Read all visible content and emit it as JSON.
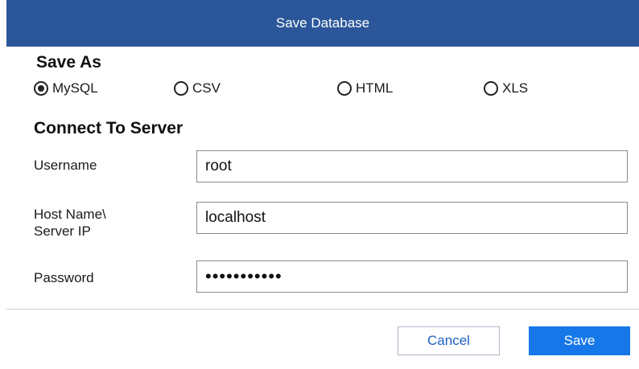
{
  "window": {
    "title": "Save Database"
  },
  "save_as": {
    "heading": "Save As",
    "options": [
      {
        "label": "MySQL",
        "selected": true
      },
      {
        "label": "CSV",
        "selected": false
      },
      {
        "label": "HTML",
        "selected": false
      },
      {
        "label": "XLS",
        "selected": false
      }
    ]
  },
  "server": {
    "heading": "Connect To Server",
    "username": {
      "label": "Username",
      "value": "root"
    },
    "host": {
      "label_line1": "Host Name\\",
      "label_line2": "Server IP",
      "value": "localhost"
    },
    "password": {
      "label": "Password",
      "value": "•••••••••••"
    }
  },
  "buttons": {
    "cancel": "Cancel",
    "save": "Save"
  },
  "colors": {
    "titlebar": "#2b579a",
    "primary": "#1677e8",
    "cancel_text": "#1f5fbf"
  }
}
